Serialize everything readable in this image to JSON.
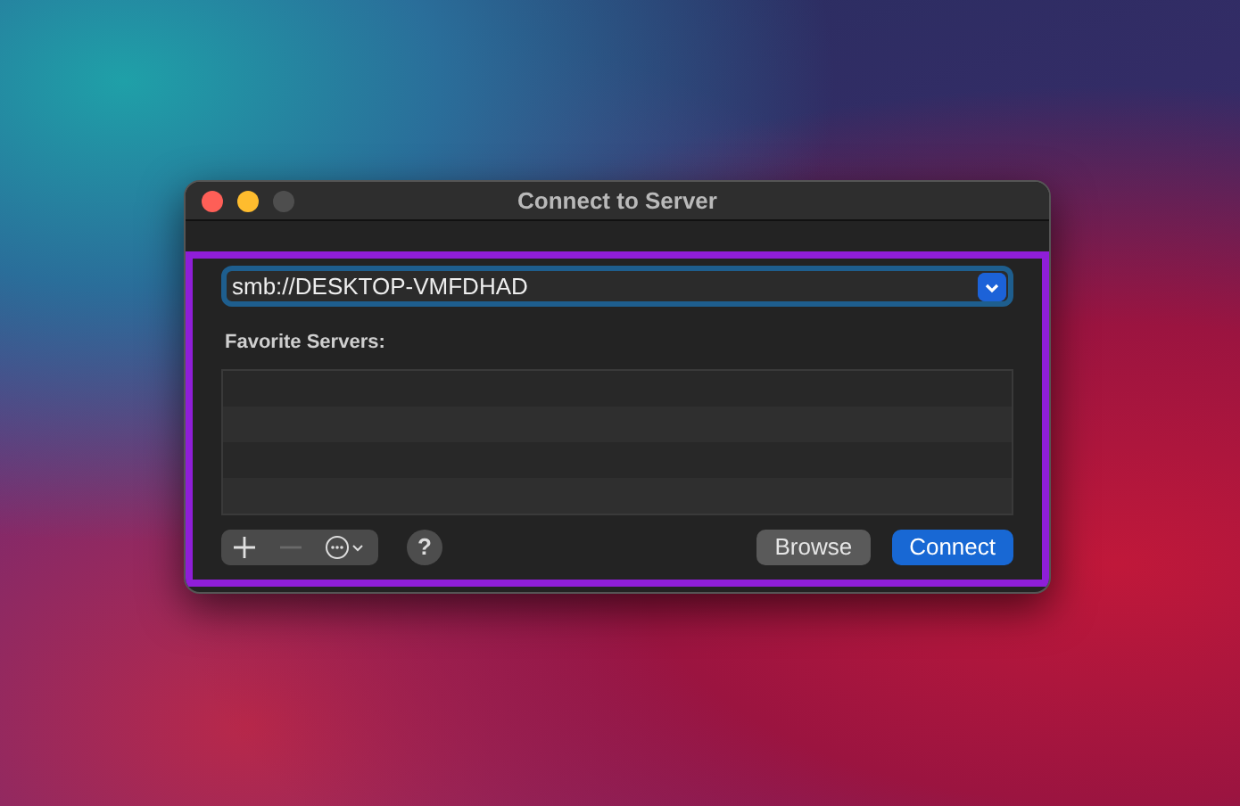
{
  "window": {
    "title": "Connect to Server"
  },
  "address": {
    "value": "smb://DESKTOP-VMFDHAD"
  },
  "favorites": {
    "label": "Favorite Servers:"
  },
  "toolbar": {
    "add_disabled": false,
    "remove_disabled": true,
    "help_label": "?"
  },
  "buttons": [
    {
      "label": "Browse",
      "kind": "secondary"
    },
    {
      "label": "Connect",
      "kind": "primary"
    }
  ]
}
